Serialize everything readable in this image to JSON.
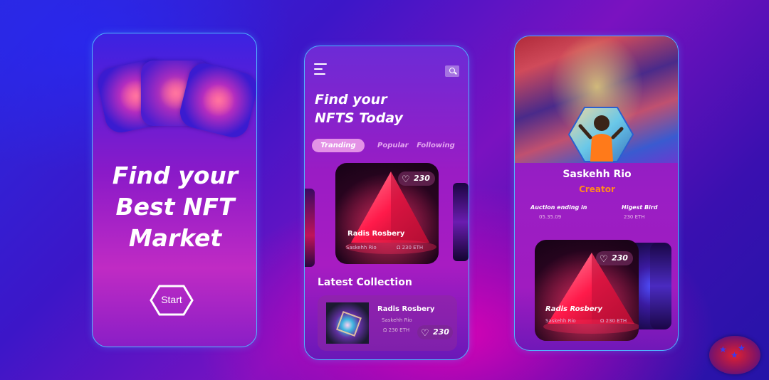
{
  "colors": {
    "frame_border": "#4fb8ff",
    "accent_pink": "#e392e6",
    "creator_orange": "#ff8a1e",
    "tab_inactive": "#e4a7f0"
  },
  "screen1": {
    "title_line1": "Find your",
    "title_line2": "Best NFT",
    "title_line3": "Market",
    "start_label": "Start"
  },
  "screen2": {
    "menu_icon": "menu-icon",
    "search_icon": "search-icon",
    "title_line1": "Find your",
    "title_line2": "NFTS Today",
    "tabs": [
      {
        "label": "Tranding",
        "active": true
      },
      {
        "label": "Popular",
        "active": false
      },
      {
        "label": "Following",
        "active": false
      }
    ],
    "featured": {
      "likes": "230",
      "name": "Radis Rosbery",
      "creator": "Saskehh Rio",
      "price": "Ω 230 ETH"
    },
    "latest_title": "Latest Collection",
    "latest_item": {
      "name": "Radis Rosbery",
      "creator": "Saskehh Rio",
      "price": "Ω 230 ETH",
      "likes": "230"
    }
  },
  "screen3": {
    "name": "Saskehh Rio",
    "role": "Creator",
    "auction_label": "Auction ending in",
    "auction_value": "05.35.09",
    "bid_label": "Higest Bird",
    "bid_value": "230 ETH",
    "card": {
      "likes": "230",
      "name": "Radis Rosbery",
      "creator": "Saskehh Rio",
      "price": "Ω 230 ETH"
    }
  }
}
